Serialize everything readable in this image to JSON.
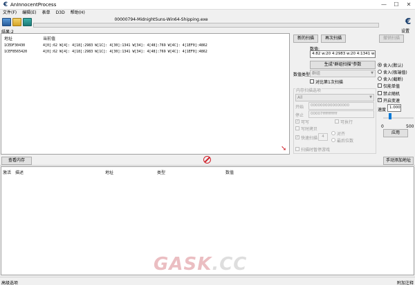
{
  "window": {
    "title": "AnInnocentProcess",
    "minimize": "—",
    "maximize": "☐",
    "close": "✕"
  },
  "menu": [
    "文件(F)",
    "编辑(E)",
    "表单",
    "D3D",
    "帮助(H)"
  ],
  "toolbar": {
    "process": "00000794-MidnightSuns-Win64-Shipping.exe",
    "settings_label": "设置",
    "logo_glyph": "€",
    "icons": [
      "computer-icon",
      "open-folder-icon",
      "save-disk-icon"
    ]
  },
  "results": {
    "found_label": "结果:2",
    "columns": [
      "地址",
      "当前值"
    ],
    "rows": [
      {
        "address": "1CEDF30430",
        "value": "4[0]:62 W[4]: 4[18]:2983 W[1C]: 4[30]:1341 W[34]: 4[48]:769 W[4C]: 4[1EF0]:4862"
      },
      {
        "address": "1CEF8565420",
        "value": "4[0]:62 W[4]: 4[18]:2983 W[1C]: 4[30]:1341 W[34]: 4[48]:769 W[4C]: 4[1EF0]:4862"
      }
    ]
  },
  "scan": {
    "new_scan": "新的扫描",
    "next_scan": "再次扫描",
    "undo_scan": "撤销扫描",
    "value_label": "数值:",
    "value": "4:82 w:20 4:2983 w:20 4:1341 w:20 4:769 w:7844 4:4862",
    "generate_params": "生成\"群组扫描\"参数",
    "value_type_label": "数值类型",
    "value_type": "群组",
    "compare_first": "对比第1次扫描",
    "memory_options_label": "内存扫描选项",
    "memory_region": "All",
    "start_label": "开始",
    "start_value": "0000000000000000",
    "stop_label": "停止",
    "stop_value": "00007fffffffffff",
    "writable": "可写",
    "executable": "可执行",
    "copy_on_write": "写时拷贝",
    "fast_scan": "快速扫描",
    "fast_scan_value": "4",
    "align": "对齐",
    "last_digits": "最后位数",
    "pause_game": "扫描时暂停游戏"
  },
  "options": {
    "round_default": "舍入(默认)",
    "round_extreme": "舍入(极端值)",
    "truncate": "舍入(截断)",
    "unicode": "仅能单值",
    "no_random": "禁止随机",
    "speedhack": "开启变速",
    "speed_label": "速度",
    "speed_value": "1.000",
    "slider_min": "0",
    "slider_max": "500",
    "apply": "应用"
  },
  "bottom": {
    "view_memory": "查看内存",
    "add_address": "手动添加地址",
    "columns": [
      "激活",
      "描述",
      "地址",
      "类型",
      "数值"
    ],
    "advanced": "高级选项",
    "table_extras": "附加注释"
  },
  "watermark": {
    "brand": "GASK",
    "tld": ".CC"
  }
}
